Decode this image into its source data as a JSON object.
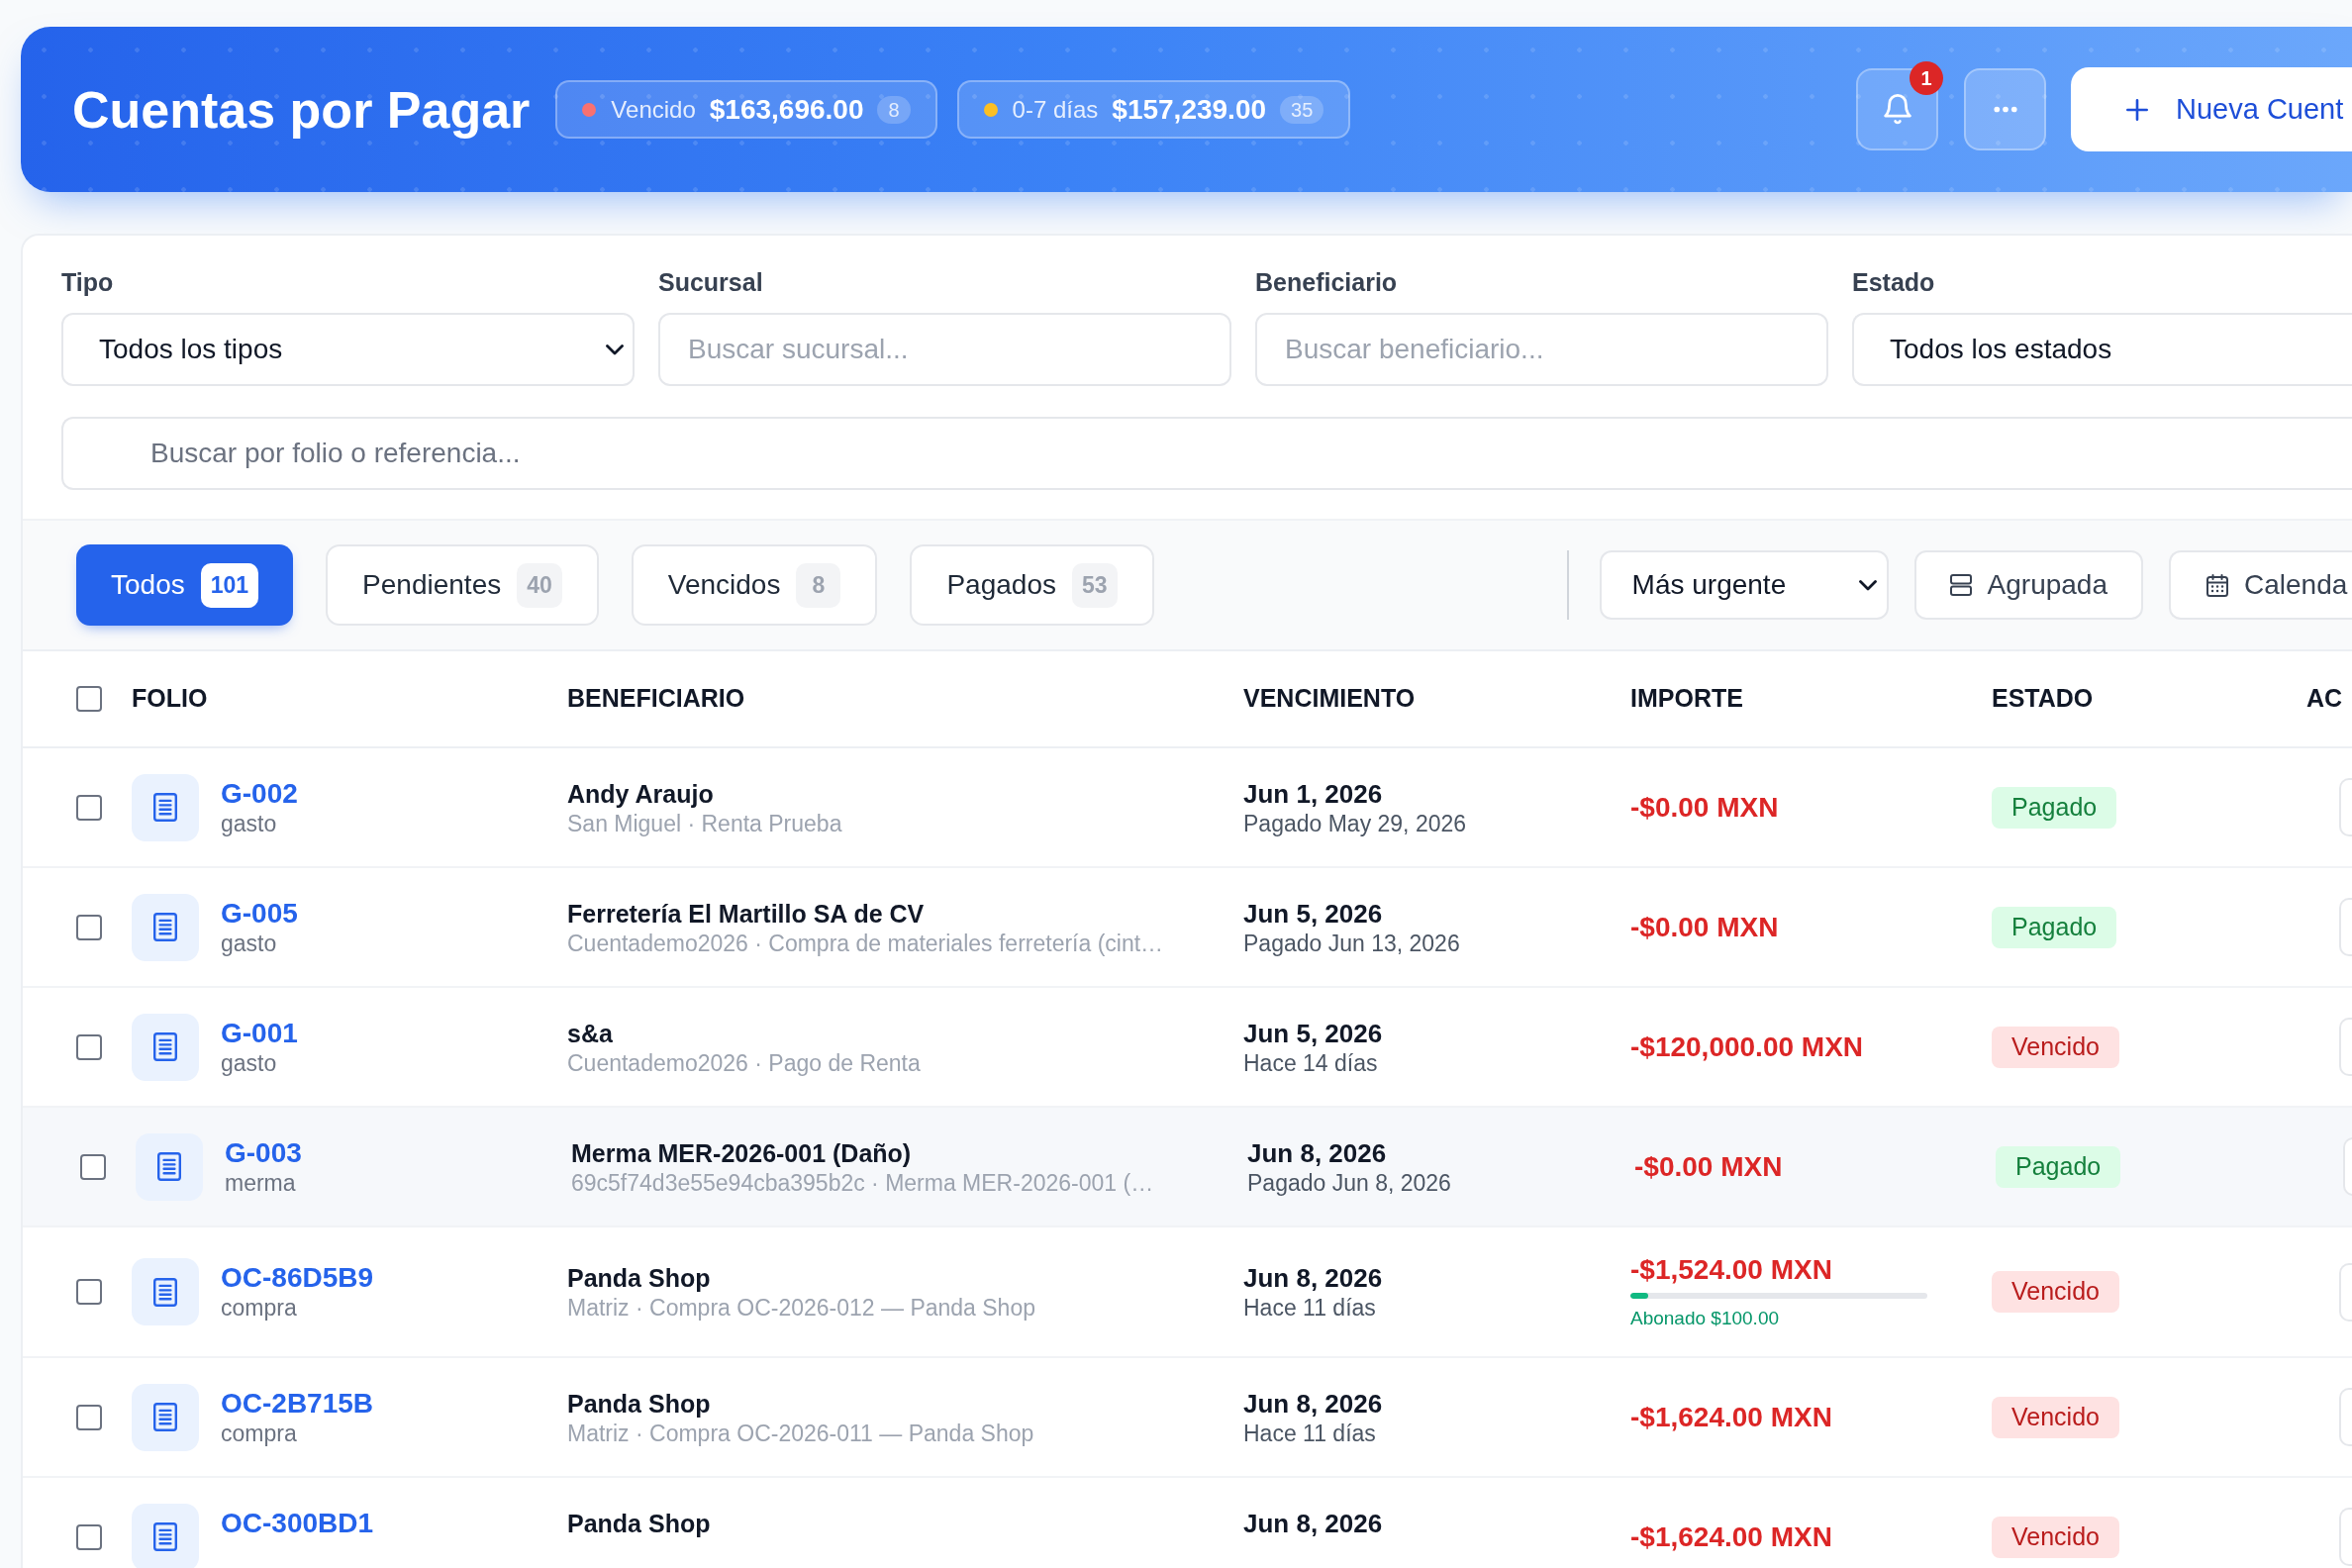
{
  "header": {
    "title": "Cuentas por Pagar",
    "summary_pills": [
      {
        "label": "Vencido",
        "amount": "$163,696.00",
        "count": "8",
        "color": "#f87171"
      },
      {
        "label": "0-7 días",
        "amount": "$157,239.00",
        "count": "35",
        "color": "#fbbf24"
      }
    ],
    "notifications_badge": "1",
    "new_button": {
      "label": "Nueva Cuent"
    }
  },
  "filters": [
    {
      "kind": "dropdown",
      "label": "Tipo",
      "value": "Todos los tipos"
    },
    {
      "kind": "text",
      "label": "Sucursal",
      "placeholder": "Buscar sucursal..."
    },
    {
      "kind": "text",
      "label": "Beneficiario",
      "placeholder": "Buscar beneficiario..."
    },
    {
      "kind": "dropdown",
      "label": "Estado",
      "value": "Todos los estados"
    }
  ],
  "search": {
    "placeholder": "Buscar por folio o referencia..."
  },
  "tabs": [
    {
      "label": "Todos",
      "count": "101",
      "selected": true
    },
    {
      "label": "Pendientes",
      "count": "40",
      "selected": false
    },
    {
      "label": "Vencidos",
      "count": "8",
      "selected": false
    },
    {
      "label": "Pagados",
      "count": "53",
      "selected": false
    }
  ],
  "sort": {
    "value": "Más urgente"
  },
  "view_buttons": [
    {
      "kind": "grouped",
      "label": "Agrupada"
    },
    {
      "kind": "calendar",
      "label": "Calenda"
    }
  ],
  "table": {
    "header_checkbox": {
      "checked": false
    },
    "columns": [
      "FOLIO",
      "BENEFICIARIO",
      "VENCIMIENTO",
      "IMPORTE",
      "ESTADO",
      "AC"
    ],
    "rows": [
      {
        "checked": false,
        "hovered": false,
        "folio": "G-002",
        "type": "gasto",
        "beneficiary": "Andy Araujo",
        "detail": "San Miguel · Renta Prueba",
        "due_date": "Jun 1, 2026",
        "due_note": "Pagado May 29, 2026",
        "amount": "-$0.00 MXN",
        "status": {
          "kind": "paid",
          "label": "Pagado"
        }
      },
      {
        "checked": false,
        "hovered": false,
        "folio": "G-005",
        "type": "gasto",
        "beneficiary": "Ferretería El Martillo SA de CV",
        "detail": "Cuentademo2026 · Compra de materiales ferretería (cint…",
        "due_date": "Jun 5, 2026",
        "due_note": "Pagado Jun 13, 2026",
        "amount": "-$0.00 MXN",
        "status": {
          "kind": "paid",
          "label": "Pagado"
        }
      },
      {
        "checked": false,
        "hovered": false,
        "folio": "G-001",
        "type": "gasto",
        "beneficiary": "s&a",
        "detail": "Cuentademo2026 · Pago de Renta",
        "due_date": "Jun 5, 2026",
        "due_note": "Hace 14 días",
        "amount": "-$120,000.00 MXN",
        "status": {
          "kind": "overdue",
          "label": "Vencido"
        }
      },
      {
        "checked": false,
        "hovered": true,
        "folio": "G-003",
        "type": "merma",
        "beneficiary": "Merma MER-2026-001 (Daño)",
        "detail": "69c5f74d3e55e94cba395b2c · Merma MER-2026-001 (…",
        "due_date": "Jun 8, 2026",
        "due_note": "Pagado Jun 8, 2026",
        "amount": "-$0.00 MXN",
        "status": {
          "kind": "paid",
          "label": "Pagado"
        }
      },
      {
        "checked": false,
        "hovered": false,
        "folio": "OC-86D5B9",
        "type": "compra",
        "beneficiary": "Panda Shop",
        "detail": "Matriz · Compra OC-2026-012 — Panda Shop",
        "due_date": "Jun 8, 2026",
        "due_note": "Hace 11 días",
        "amount": "-$1,524.00 MXN",
        "payment": {
          "label": "Abonado $100.00",
          "level": 0.06
        },
        "status": {
          "kind": "overdue",
          "label": "Vencido"
        }
      },
      {
        "checked": false,
        "hovered": false,
        "folio": "OC-2B715B",
        "type": "compra",
        "beneficiary": "Panda Shop",
        "detail": "Matriz · Compra OC-2026-011 — Panda Shop",
        "due_date": "Jun 8, 2026",
        "due_note": "Hace 11 días",
        "amount": "-$1,624.00 MXN",
        "status": {
          "kind": "overdue",
          "label": "Vencido"
        }
      },
      {
        "checked": false,
        "hovered": false,
        "folio": "OC-300BD1",
        "beneficiary": "Panda Shop",
        "due_date": "Jun 8, 2026",
        "amount": "-$1,624.00 MXN",
        "status": {
          "kind": "overdue",
          "label": "Vencido"
        }
      }
    ]
  }
}
